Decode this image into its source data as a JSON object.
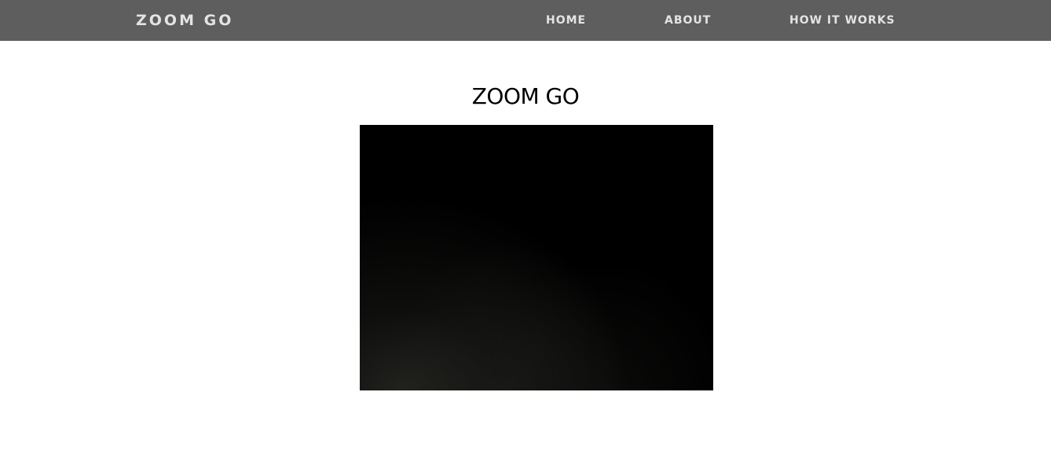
{
  "navbar": {
    "brand": "ZOOM GO",
    "background_color": "#5e5e5e",
    "text_color": "#e4e4e4",
    "links": [
      {
        "label": "HOME"
      },
      {
        "label": "ABOUT"
      },
      {
        "label": "HOW IT WORKS"
      }
    ]
  },
  "main": {
    "title": "ZOOM GO",
    "video": {
      "content": "dark camera feed"
    }
  }
}
